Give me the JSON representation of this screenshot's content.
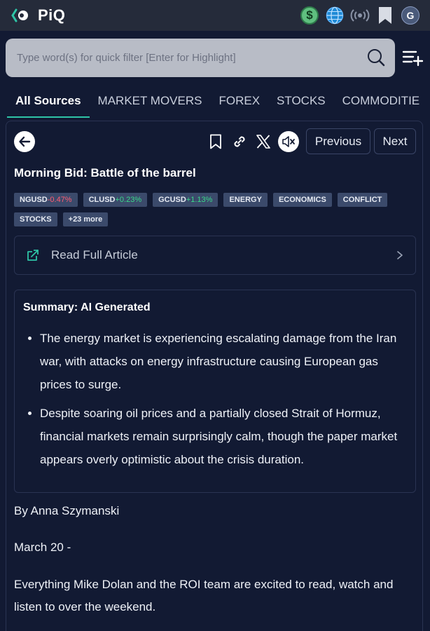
{
  "header": {
    "logo_text": "PiQ",
    "avatar_initial": "G",
    "dollar_symbol": "$"
  },
  "search": {
    "placeholder": "Type word(s) for quick filter [Enter for Highlight]"
  },
  "tabs": [
    {
      "label": "All Sources",
      "active": true
    },
    {
      "label": "MARKET MOVERS"
    },
    {
      "label": "FOREX"
    },
    {
      "label": "STOCKS"
    },
    {
      "label": "COMMODITIE"
    }
  ],
  "article": {
    "previous_label": "Previous",
    "next_label": "Next",
    "title": "Morning Bid: Battle of the barrel",
    "tickers": [
      {
        "symbol": "NGUSD",
        "change": "-0.47%"
      },
      {
        "symbol": "CLUSD",
        "change": "+0.23%"
      },
      {
        "symbol": "GCUSD",
        "change": "+1.13%"
      }
    ],
    "tags": [
      "ENERGY",
      "ECONOMICS",
      "CONFLICT",
      "STOCKS",
      "+23 more"
    ],
    "read_full_label": "Read Full Article",
    "summary": {
      "title": "Summary: AI Generated",
      "bullets": [
        "The energy market is experiencing escalating damage from the Iran war, with attacks on energy infrastructure causing European gas prices to surge.",
        "Despite soaring oil prices and a partially closed Strait of Hormuz, financial markets remain surprisingly calm, though the paper market appears overly optimistic about the crisis duration."
      ]
    },
    "byline": "By Anna Szymanski",
    "dateline": "March 20 -",
    "paragraph": "Everything Mike Dolan and the ROI team are excited to read, watch and listen to over the weekend."
  },
  "colors": {
    "accent": "#2ec4a6",
    "negative": "#ff5c72",
    "positive": "#39d98a",
    "tag_bg": "#3b4a6b"
  }
}
